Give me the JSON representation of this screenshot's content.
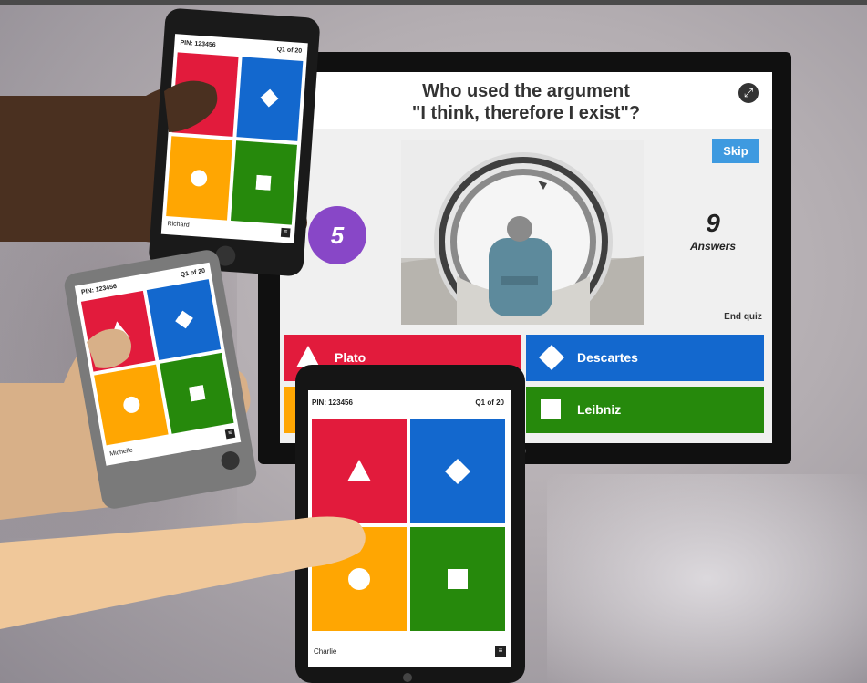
{
  "quiz": {
    "question": "Who used the argument \"I think, therefore I exist\"?",
    "question_line1": "Who used the argument",
    "question_line2": "\"I think, therefore I exist\"?",
    "skip_label": "Skip",
    "timer_value": "5",
    "answers_count": "9",
    "answers_label": "Answers",
    "end_quiz_label": "End quiz",
    "answers": [
      {
        "label": "Plato",
        "color": "#e21b3c",
        "shape": "triangle"
      },
      {
        "label": "Descartes",
        "color": "#1368ce",
        "shape": "diamond"
      },
      {
        "label": "",
        "color": "#ffa602",
        "shape": "circle"
      },
      {
        "label": "Leibniz",
        "color": "#26890c",
        "shape": "square"
      }
    ]
  },
  "devices": {
    "phone_top": {
      "pin": "PIN: 123456",
      "question_counter": "Q1 of 20",
      "player": "Richard"
    },
    "phone_left": {
      "pin": "PIN: 123456",
      "question_counter": "Q1 of 20",
      "player": "Michelle"
    },
    "tablet": {
      "pin": "PIN: 123456",
      "question_counter": "Q1 of 20",
      "player": "Charlie"
    }
  },
  "icons": {
    "fullscreen": "fullscreen-icon",
    "menu": "menu-icon",
    "shapes": [
      "triangle-icon",
      "diamond-icon",
      "circle-icon",
      "square-icon"
    ]
  },
  "colors": {
    "red": "#e21b3c",
    "blue": "#1368ce",
    "orange": "#ffa602",
    "green": "#26890c",
    "purple": "#8847c7",
    "skip_blue": "#3e9ae0"
  }
}
